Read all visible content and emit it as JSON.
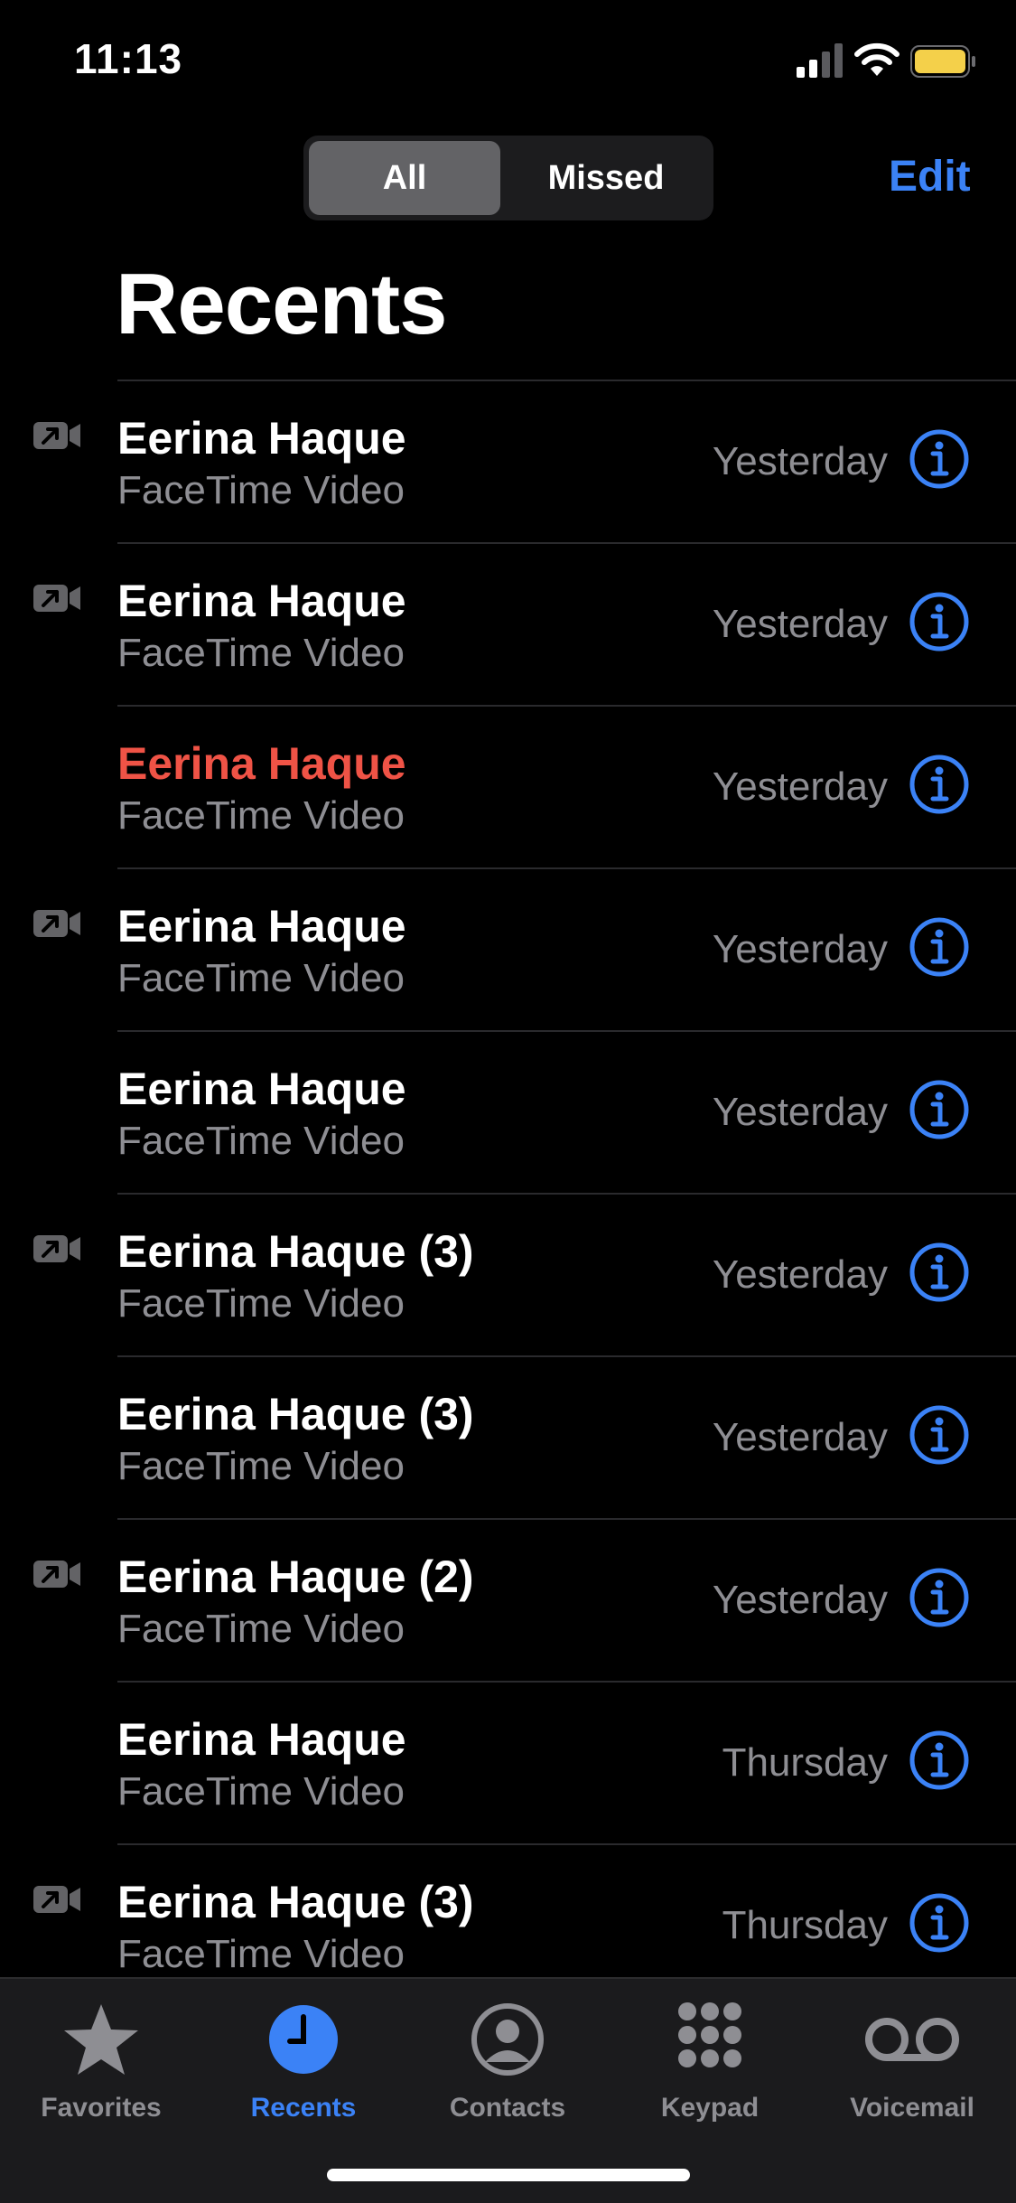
{
  "status": {
    "time": "11:13"
  },
  "header": {
    "segments": [
      "All",
      "Missed"
    ],
    "edit_label": "Edit",
    "title": "Recents"
  },
  "calls": [
    {
      "name": "Eerina Haque",
      "type": "FaceTime Video",
      "date": "Yesterday",
      "outgoing": true,
      "missed": false
    },
    {
      "name": "Eerina Haque",
      "type": "FaceTime Video",
      "date": "Yesterday",
      "outgoing": true,
      "missed": false
    },
    {
      "name": "Eerina Haque",
      "type": "FaceTime Video",
      "date": "Yesterday",
      "outgoing": false,
      "missed": true
    },
    {
      "name": "Eerina Haque",
      "type": "FaceTime Video",
      "date": "Yesterday",
      "outgoing": true,
      "missed": false
    },
    {
      "name": "Eerina Haque",
      "type": "FaceTime Video",
      "date": "Yesterday",
      "outgoing": false,
      "missed": false
    },
    {
      "name": "Eerina Haque (3)",
      "type": "FaceTime Video",
      "date": "Yesterday",
      "outgoing": true,
      "missed": false
    },
    {
      "name": "Eerina Haque (3)",
      "type": "FaceTime Video",
      "date": "Yesterday",
      "outgoing": false,
      "missed": false
    },
    {
      "name": "Eerina Haque (2)",
      "type": "FaceTime Video",
      "date": "Yesterday",
      "outgoing": true,
      "missed": false
    },
    {
      "name": "Eerina Haque",
      "type": "FaceTime Video",
      "date": "Thursday",
      "outgoing": false,
      "missed": false
    },
    {
      "name": "Eerina Haque (3)",
      "type": "FaceTime Video",
      "date": "Thursday",
      "outgoing": true,
      "missed": false
    }
  ],
  "tabs": [
    {
      "label": "Favorites",
      "icon": "star-icon",
      "active": false
    },
    {
      "label": "Recents",
      "icon": "clock-icon",
      "active": true
    },
    {
      "label": "Contacts",
      "icon": "person-circle-icon",
      "active": false
    },
    {
      "label": "Keypad",
      "icon": "keypad-icon",
      "active": false
    },
    {
      "label": "Voicemail",
      "icon": "voicemail-icon",
      "active": false
    }
  ],
  "colors": {
    "accent": "#3b82f6",
    "missed": "#ef5346",
    "secondary": "#8e8e93",
    "battery": "#f4d04a"
  }
}
